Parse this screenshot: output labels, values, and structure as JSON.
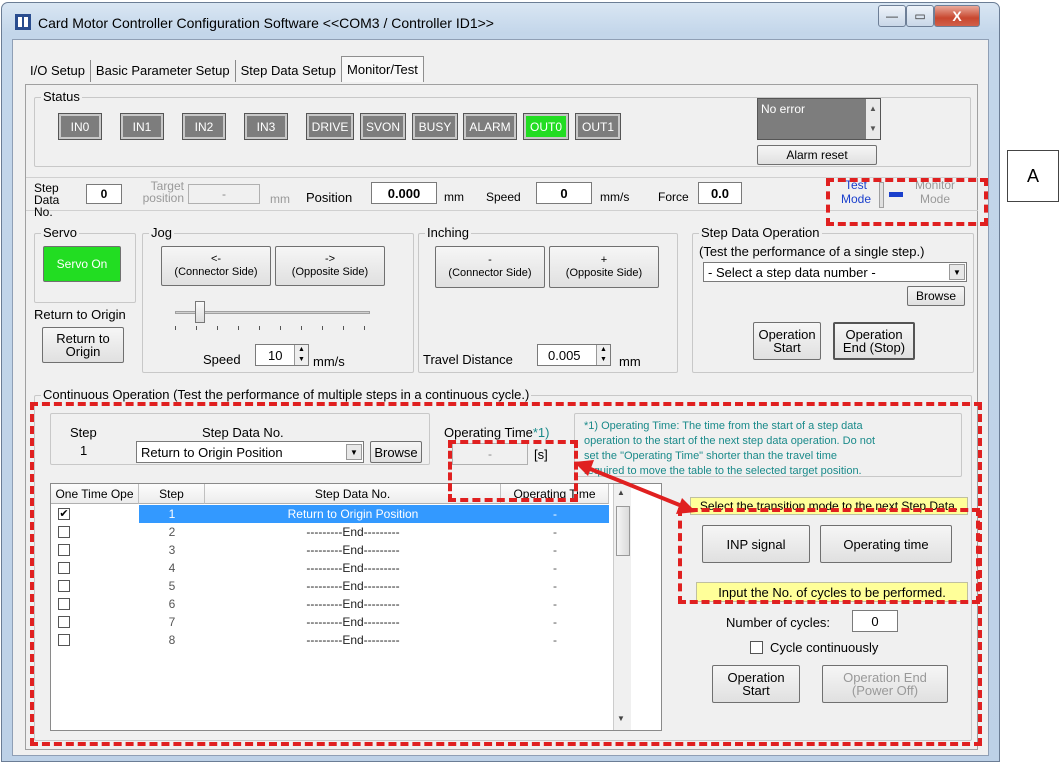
{
  "window": {
    "title": "Card Motor Controller Configuration Software <<COM3 / Controller ID1>>",
    "minimize": "—",
    "maximize": "▭",
    "close": "X"
  },
  "tabs": [
    "I/O Setup",
    "Basic Parameter Setup",
    "Step Data Setup",
    "Monitor/Test"
  ],
  "status": {
    "label": "Status",
    "leds": [
      "IN0",
      "IN1",
      "IN2",
      "IN3",
      "DRIVE",
      "SVON",
      "BUSY",
      "ALARM",
      "OUT0",
      "OUT1"
    ],
    "message": "No error",
    "alarm_reset": "Alarm reset"
  },
  "annotation_A": "A",
  "monitor_row": {
    "step_data_label": "Step Data No.",
    "step_data_value": "0",
    "target_label": "Target position",
    "target_value": "-",
    "target_unit": "mm",
    "position_label": "Position",
    "position_value": "0.000",
    "position_unit": "mm",
    "speed_label": "Speed",
    "speed_value": "0",
    "speed_unit": "mm/s",
    "force_label": "Force",
    "force_value": "0.0",
    "test_mode": "Test Mode",
    "monitor_mode": "Monitor Mode"
  },
  "servo": {
    "label": "Servo",
    "button": "Servo On",
    "return_label": "Return to Origin",
    "return_button": "Return to Origin"
  },
  "jog": {
    "label": "Jog",
    "left_arrow": "<-",
    "left_text": "(Connector Side)",
    "right_arrow": "->",
    "right_text": "(Opposite Side)",
    "speed_label": "Speed",
    "speed_value": "10",
    "speed_unit": "mm/s"
  },
  "inching": {
    "label": "Inching",
    "minus": "-",
    "minus_text": "(Connector Side)",
    "plus": "+",
    "plus_text": "(Opposite Side)",
    "travel_label": "Travel Distance",
    "travel_value": "0.005",
    "travel_unit": "mm"
  },
  "step_op": {
    "label": "Step Data Operation",
    "heading": "(Test the performance of a single step.)",
    "select": "- Select a step data number -",
    "browse": "Browse",
    "start": "Operation Start",
    "end": "Operation End (Stop)"
  },
  "continuous": {
    "label": "Continuous Operation (Test the performance of multiple steps in a continuous cycle.)",
    "step_label": "Step",
    "step_value": "1",
    "step_data_label": "Step Data No.",
    "step_data_value": "Return to Origin Position",
    "browse": "Browse",
    "op_time_label": "Operating Time",
    "op_time_mark": "*1)",
    "op_time_value": "-",
    "op_time_unit": "[s]",
    "note_line1": "*1) Operating Time: The time from the start of a step data",
    "note_line2": "operation to the start of the next step data operation. Do not",
    "note_line3": "set the \"Operating Time\" shorter than the travel time",
    "note_line4": "required to move the table to the selected target position.",
    "headers": [
      "One Time Ope",
      "Step",
      "Step Data No.",
      "Operating Time"
    ],
    "rows": [
      {
        "check": true,
        "step": "1",
        "data": "Return to Origin Position",
        "time": "-"
      },
      {
        "check": false,
        "step": "2",
        "data": "---------End---------",
        "time": "-"
      },
      {
        "check": false,
        "step": "3",
        "data": "---------End---------",
        "time": "-"
      },
      {
        "check": false,
        "step": "4",
        "data": "---------End---------",
        "time": "-"
      },
      {
        "check": false,
        "step": "5",
        "data": "---------End---------",
        "time": "-"
      },
      {
        "check": false,
        "step": "6",
        "data": "---------End---------",
        "time": "-"
      },
      {
        "check": false,
        "step": "7",
        "data": "---------End---------",
        "time": "-"
      },
      {
        "check": false,
        "step": "8",
        "data": "---------End---------",
        "time": "-"
      }
    ],
    "transition_label": "Select the transition mode to the next Step Data.",
    "inp_signal": "INP signal",
    "operating_time": "Operating time",
    "cycles_note": "Input the No. of cycles to be performed.",
    "cycles_label": "Number of cycles:",
    "cycles_value": "0",
    "cycle_continuously": "Cycle continuously",
    "op_start": "Operation Start",
    "op_end": "Operation End (Power Off)"
  },
  "colors": {
    "led_on": "#22dd22",
    "dash": "#e02020",
    "selected_row": "#3399ff",
    "note_text": "#1a8a8a"
  }
}
